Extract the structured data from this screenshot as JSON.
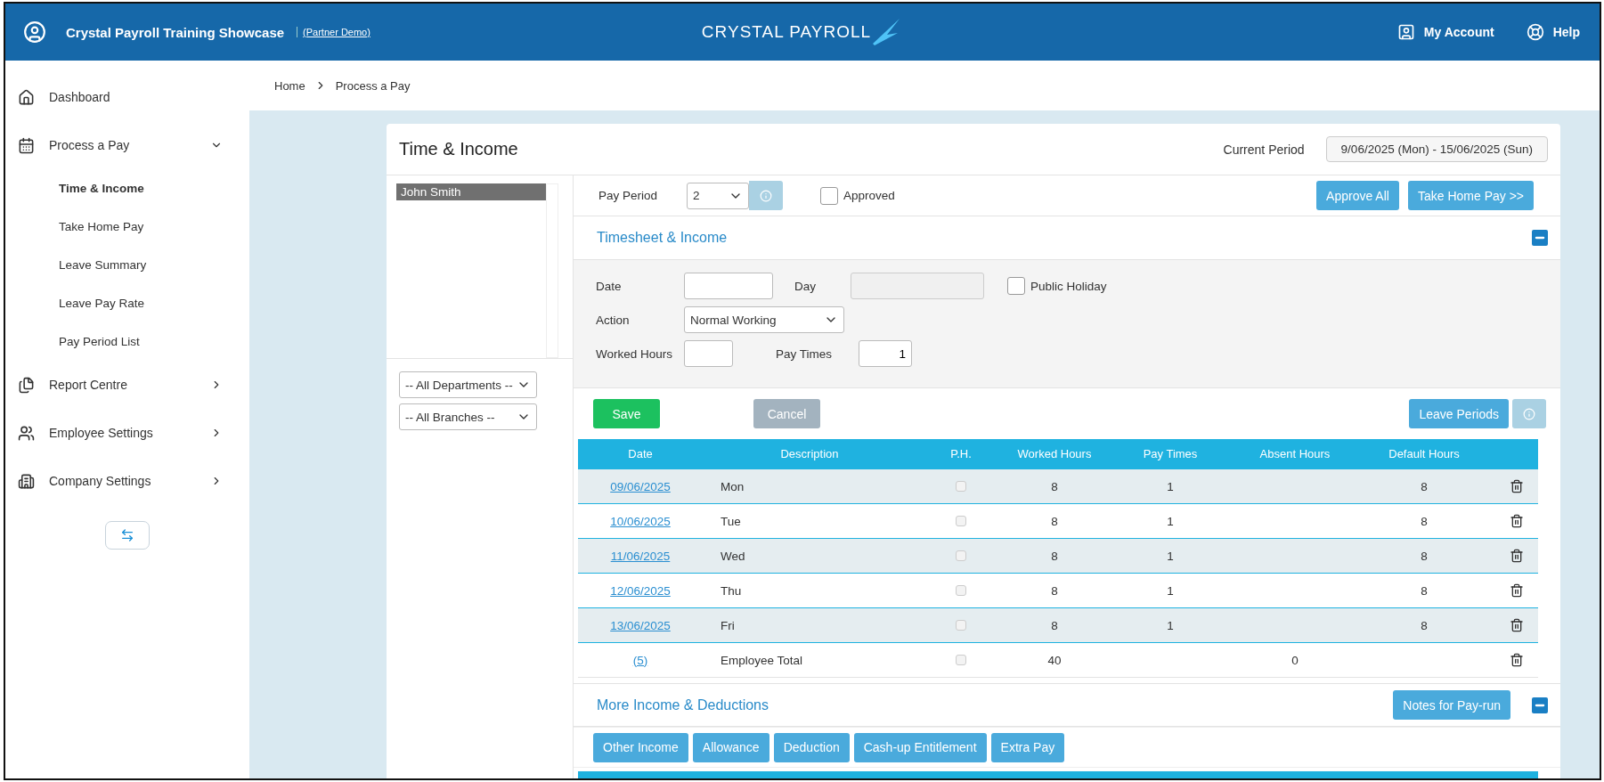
{
  "header": {
    "app_title": "Crystal Payroll Training Showcase",
    "badge": "(Partner Demo)",
    "logo": "CRYSTAL PAYROLL",
    "links": [
      {
        "label": "My Account"
      },
      {
        "label": "Help"
      }
    ]
  },
  "sidebar": {
    "items": [
      {
        "label": "Dashboard",
        "kind": "link",
        "selected": false
      },
      {
        "label": "Process a Pay",
        "kind": "group",
        "expanded": true,
        "selected": false,
        "children": [
          {
            "label": "Time & Income",
            "selected": true
          },
          {
            "label": "Take Home Pay",
            "selected": false
          },
          {
            "label": "Leave Summary",
            "selected": false
          },
          {
            "label": "Leave Pay Rate",
            "selected": false
          },
          {
            "label": "Pay Period List",
            "selected": false
          }
        ]
      },
      {
        "label": "Report Centre",
        "kind": "group",
        "expanded": false,
        "selected": false
      },
      {
        "label": "Employee Settings",
        "kind": "group",
        "expanded": false,
        "selected": false
      },
      {
        "label": "Company Settings",
        "kind": "group",
        "expanded": false,
        "selected": false
      }
    ]
  },
  "breadcrumb": [
    "Home",
    "Process a Pay"
  ],
  "card": {
    "title": "Time & Income",
    "current_period_label": "Current Period",
    "current_period": "9/06/2025 (Mon) - 15/06/2025 (Sun)"
  },
  "employees": [
    {
      "name": "John Smith",
      "selected": true
    }
  ],
  "filters": [
    {
      "value": "-- All Departments --"
    },
    {
      "value": "-- All Branches --"
    }
  ],
  "pay_period": {
    "label": "Pay Period",
    "value": "2",
    "approved_label": "Approved",
    "approved": false,
    "buttons": [
      "Approve All",
      "Take Home Pay >>"
    ]
  },
  "timesheet": {
    "title": "Timesheet & Income",
    "expanded": true,
    "date_label": "Date",
    "day_label": "Day",
    "public_holiday_label": "Public Holiday",
    "public_holiday": false,
    "action_label": "Action",
    "action": "Normal Working",
    "worked_hours_label": "Worked Hours",
    "pay_times_label": "Pay Times",
    "pay_times": "1",
    "save": "Save",
    "cancel": "Cancel",
    "leave_periods": "Leave Periods"
  },
  "table": {
    "columns": [
      "Date",
      "Description",
      "P.H.",
      "Worked Hours",
      "Pay Times",
      "Absent Hours",
      "Default Hours"
    ],
    "rows": [
      {
        "date": "09/06/2025",
        "description": "Mon",
        "ph": false,
        "worked": "8",
        "pay_times": "1",
        "default": "8"
      },
      {
        "date": "10/06/2025",
        "description": "Tue",
        "ph": false,
        "worked": "8",
        "pay_times": "1",
        "default": "8"
      },
      {
        "date": "11/06/2025",
        "description": "Wed",
        "ph": false,
        "worked": "8",
        "pay_times": "1",
        "default": "8"
      },
      {
        "date": "12/06/2025",
        "description": "Thu",
        "ph": false,
        "worked": "8",
        "pay_times": "1",
        "default": "8"
      },
      {
        "date": "13/06/2025",
        "description": "Fri",
        "ph": false,
        "worked": "8",
        "pay_times": "1",
        "default": "8"
      }
    ],
    "total": {
      "date": "(5)",
      "description": "Employee Total",
      "ph": false,
      "worked": "40",
      "absent": "0"
    }
  },
  "more": {
    "title": "More Income & Deductions",
    "expanded": true,
    "notes_button": "Notes for Pay-run",
    "tabs": [
      "Other Income",
      "Allowance",
      "Deduction",
      "Cash-up Entitlement",
      "Extra Pay"
    ]
  }
}
